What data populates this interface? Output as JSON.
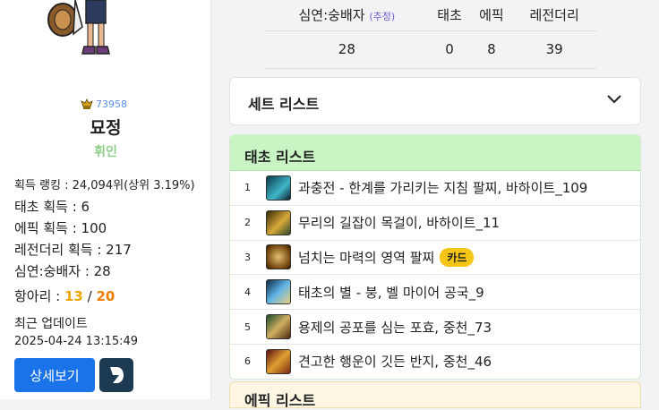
{
  "profile": {
    "badge_value": "73958",
    "name": "묘정",
    "server": "휘인",
    "rank_text": "획득 랭킹 : 24,094위(상위 3.19%)",
    "taecho_label": "태초 획득 : 6",
    "epic_label": "에픽 획득 : 100",
    "legendary_label": "레전더리 획득 : 217",
    "simyeon_label": "심연:숭배자 : 28",
    "hangari_label": "항아리 : ",
    "hangari_current": "13",
    "hangari_sep": " / ",
    "hangari_total": "20",
    "updated_label": "최근 업데이트",
    "updated_time": "2025-04-24 13:15:49",
    "detail_button": "상세보기"
  },
  "counts": {
    "headers": [
      "심연:숭배자",
      "태초",
      "에픽",
      "레전더리"
    ],
    "header_note": "(추정)",
    "values": [
      "28",
      "0",
      "8",
      "39"
    ]
  },
  "set_list": {
    "title": "세트 리스트"
  },
  "taecho_list": {
    "title": "태초 리스트",
    "items": [
      {
        "num": "1",
        "name": "과충전 - 한계를 가리키는 지침 팔찌, 바하이트_109",
        "icon": "bracelet-icon",
        "tag": ""
      },
      {
        "num": "2",
        "name": "무리의 길잡이 목걸이, 바하이트_11",
        "icon": "necklace-icon",
        "tag": ""
      },
      {
        "num": "3",
        "name": "넘치는 마력의 영역 팔찌",
        "icon": "bracelet-icon",
        "tag": "카드"
      },
      {
        "num": "4",
        "name": "태초의 별 - 붕, 벨 마이어 공국_9",
        "icon": "weapon-icon",
        "tag": ""
      },
      {
        "num": "5",
        "name": "용제의 공포를 심는 포효, 중천_73",
        "icon": "armor-icon",
        "tag": ""
      },
      {
        "num": "6",
        "name": "견고한 행운이 깃든 반지, 중천_46",
        "icon": "ring-icon",
        "tag": ""
      }
    ]
  },
  "epic_list": {
    "title": "에픽 리스트"
  },
  "colors": {
    "accent": "#1a73e8",
    "taecho_header": "#c9f5c4",
    "tag": "#f5c518",
    "server": "#8fcf8a"
  }
}
